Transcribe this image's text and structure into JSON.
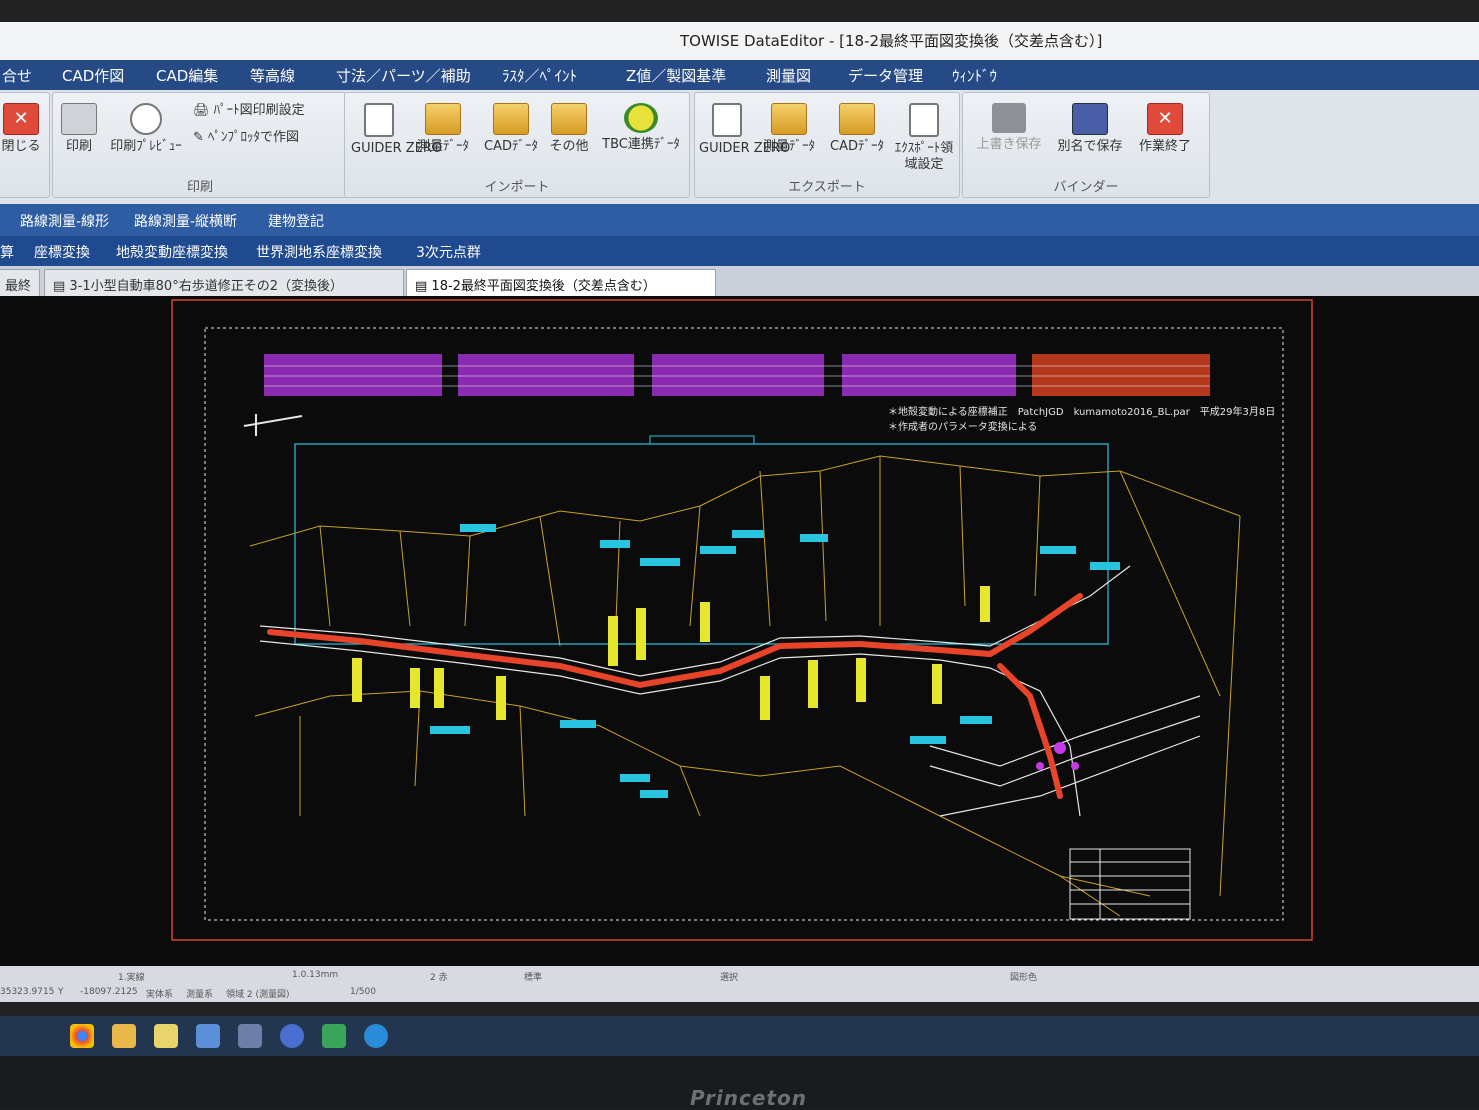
{
  "window": {
    "title": "TOWISE DataEditor - [18-2最終平面図変換後（交差点含む）]"
  },
  "menu": [
    "合せ",
    "CAD作図",
    "CAD編集",
    "等高線",
    "寸法／パーツ／補助",
    "ﾗｽﾀ／ﾍﾟｲﾝﾄ",
    "Z値／製図基準",
    "測量図",
    "データ管理",
    "ｳｨﾝﾄﾞｳ"
  ],
  "ribbon": {
    "close_label": "閉じる",
    "print_group": {
      "label": "印刷",
      "print": "印刷",
      "preview": "印刷ﾌﾟﾚﾋﾞｭｰ",
      "part_print_settings": "ﾊﾟｰﾄ図印刷設定",
      "pen_plotter": "ﾍﾟﾝﾌﾟﾛｯﾀで作図"
    },
    "import_group": {
      "label": "インポート",
      "buttons": [
        "GUIDER ZERO",
        "測量ﾃﾞｰﾀ",
        "CADﾃﾞｰﾀ",
        "その他",
        "TBC連携ﾃﾞｰﾀ"
      ]
    },
    "export_group": {
      "label": "エクスポート",
      "buttons": [
        "GUIDER ZERO",
        "測量ﾃﾞｰﾀ",
        "CADﾃﾞｰﾀ",
        "ｴｸｽﾎﾟｰﾄ領域設定"
      ]
    },
    "binder_group": {
      "label": "バインダー",
      "buttons": [
        "上書き保存",
        "別名で保存",
        "作業終了"
      ]
    }
  },
  "subtabs1": [
    "路線測量-線形",
    "路線測量-縦横断",
    "建物登記"
  ],
  "subtabs2": [
    "算",
    "座標変換",
    "地殻変動座標変換",
    "世界測地系座標変換",
    "3次元点群"
  ],
  "doc_tabs": [
    "最終",
    "3-1小型自動車80°右歩道修正その2（変換後）",
    "18-2最終平面図変換後（交差点含む）"
  ],
  "drawing": {
    "note1": "＊地殻変動による座標補正　PatchJGD　kumamoto2016_BL.par　平成29年3月8日",
    "note2": "＊作成者のパラメータ変換による",
    "colors": {
      "background": "#0b0b0c",
      "road": "#e8442a",
      "text_yellow": "#e6e72c",
      "cyan": "#29c4e0",
      "magenta": "#c43ae6",
      "parcel": "#c9a227",
      "white": "#e6e6e6",
      "frame": "#d8452a"
    }
  },
  "statusbar": {
    "items": [
      "1.実線",
      "1.0.13mm",
      "2 赤",
      "標準",
      "選択",
      "図形色"
    ],
    "coords": [
      "35323.9715",
      "Y",
      "-18097.2125",
      "実体系",
      "測量系",
      "領域 2 (測量図)",
      "1/500"
    ]
  },
  "monitor_brand": "Princeton"
}
